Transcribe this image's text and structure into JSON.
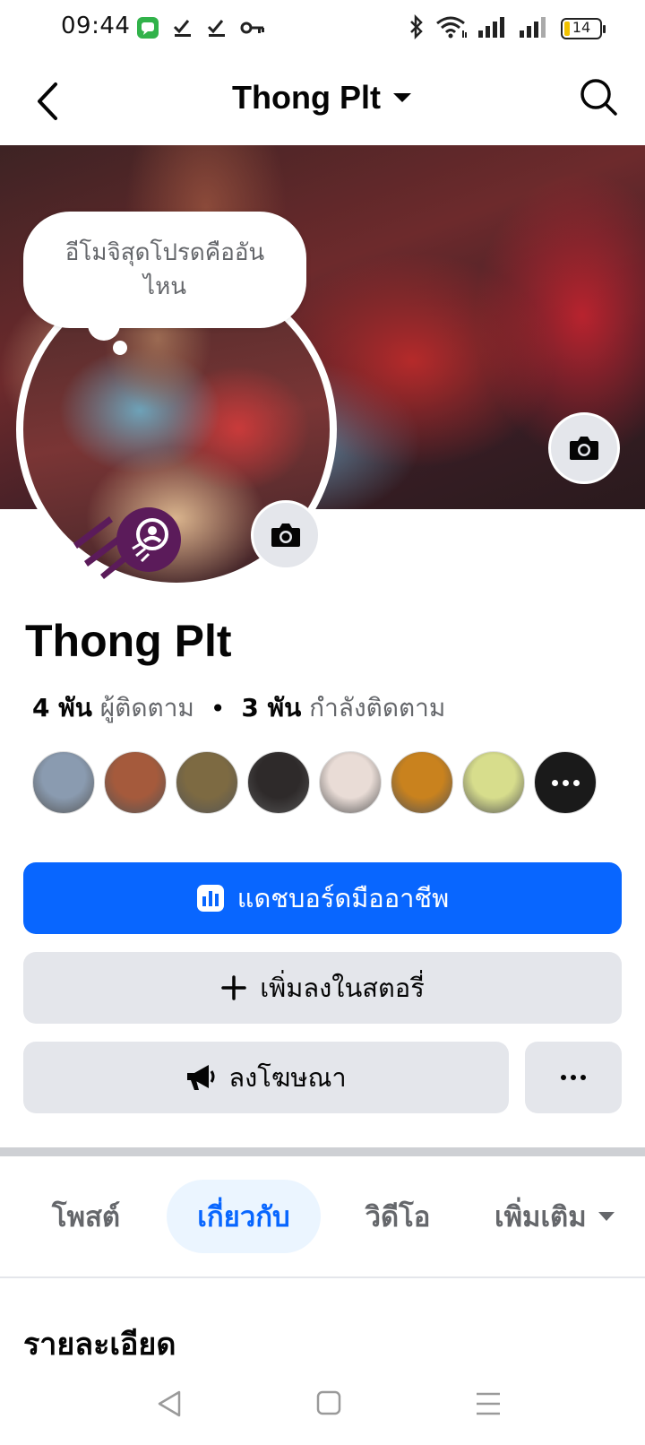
{
  "status_bar": {
    "time": "09:44",
    "battery": "14"
  },
  "header": {
    "title": "Thong Plt"
  },
  "note": {
    "text": "อีโมจิสุดโปรดคืออันไหน"
  },
  "profile": {
    "name": "Thong Plt",
    "followers_count": "4 พัน",
    "followers_label": "ผู้ติดตาม",
    "following_count": "3 พัน",
    "following_label": "กำลังติดตาม"
  },
  "friends": [
    {
      "name": "friend-1",
      "color": "#8a9bb0"
    },
    {
      "name": "friend-2",
      "color": "#a55a3c"
    },
    {
      "name": "friend-3",
      "color": "#7d6a42"
    },
    {
      "name": "friend-4",
      "color": "#2e2a2a"
    },
    {
      "name": "friend-5",
      "color": "#e9dcd6"
    },
    {
      "name": "friend-6",
      "color": "#c9821e"
    },
    {
      "name": "friend-7",
      "color": "#d7dd8c"
    }
  ],
  "actions": {
    "dashboard": "แดชบอร์ดมืออาชีพ",
    "add_story": "เพิ่มลงในสตอรี่",
    "advertise": "ลงโฆษณา"
  },
  "tabs": [
    {
      "label": "โพสต์",
      "active": false
    },
    {
      "label": "เกี่ยวกับ",
      "active": true
    },
    {
      "label": "วิดีโอ",
      "active": false
    },
    {
      "label": "เพิ่มเติม",
      "active": false
    }
  ],
  "section": {
    "title": "รายละเอียด"
  },
  "colors": {
    "primary": "#0866ff",
    "secondary_button": "#e4e6eb",
    "active_tab_bg": "#ebf5ff"
  }
}
